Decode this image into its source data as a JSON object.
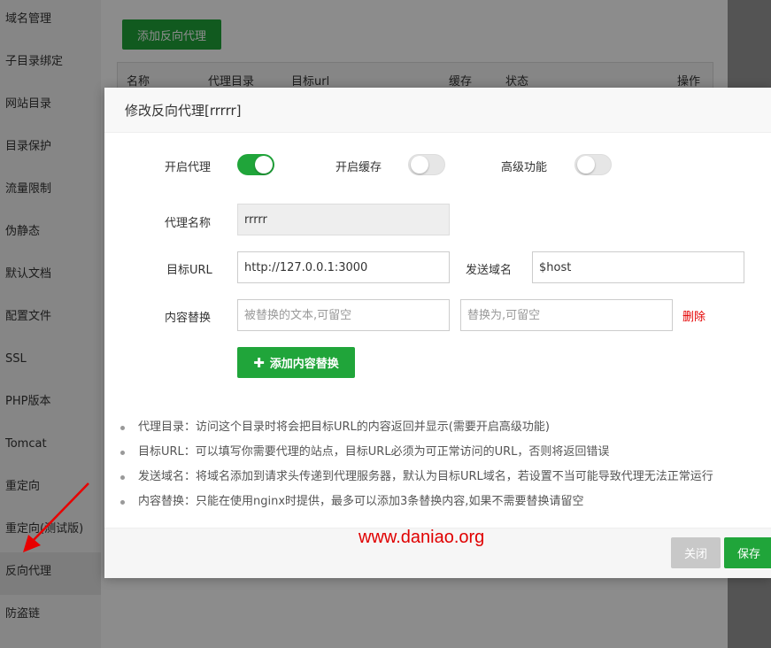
{
  "sidebar": {
    "items": [
      {
        "label": "域名管理"
      },
      {
        "label": "子目录绑定"
      },
      {
        "label": "网站目录"
      },
      {
        "label": "目录保护"
      },
      {
        "label": "流量限制"
      },
      {
        "label": "伪静态"
      },
      {
        "label": "默认文档"
      },
      {
        "label": "配置文件"
      },
      {
        "label": "SSL"
      },
      {
        "label": "PHP版本"
      },
      {
        "label": "Tomcat"
      },
      {
        "label": "重定向"
      },
      {
        "label": "重定向(测试版)"
      },
      {
        "label": "反向代理"
      },
      {
        "label": "防盗链"
      }
    ]
  },
  "page": {
    "add_proxy_label": "添加反向代理",
    "table_headers": [
      "名称",
      "代理目录",
      "目标url",
      "缓存",
      "状态",
      "操作"
    ]
  },
  "modal": {
    "title": "修改反向代理[rrrrr]",
    "enable_proxy_label": "开启代理",
    "enable_proxy_on": true,
    "enable_cache_label": "开启缓存",
    "enable_cache_on": false,
    "advanced_label": "高级功能",
    "advanced_on": false,
    "proxy_name_label": "代理名称",
    "proxy_name_value": "rrrrr",
    "target_url_label": "目标URL",
    "target_url_value": "http://127.0.0.1:3000",
    "send_domain_label": "发送域名",
    "send_domain_value": "$host",
    "content_replace_label": "内容替换",
    "replace_from_placeholder": "被替换的文本,可留空",
    "replace_to_placeholder": "替换为,可留空",
    "delete_label": "删除",
    "add_replace_label": "添加内容替换",
    "notes": [
      "代理目录：访问这个目录时将会把目标URL的内容返回并显示(需要开启高级功能)",
      "目标URL：可以填写你需要代理的站点，目标URL必须为可正常访问的URL，否则将返回错误",
      "发送域名：将域名添加到请求头传递到代理服务器，默认为目标URL域名，若设置不当可能导致代理无法正常运行",
      "内容替换：只能在使用nginx时提供，最多可以添加3条替换内容,如果不需要替换请留空"
    ],
    "close_label": "关闭",
    "save_label": "保存"
  },
  "watermark": "www.daniao.org",
  "colors": {
    "accent": "#20a53a",
    "danger": "#e40000"
  }
}
